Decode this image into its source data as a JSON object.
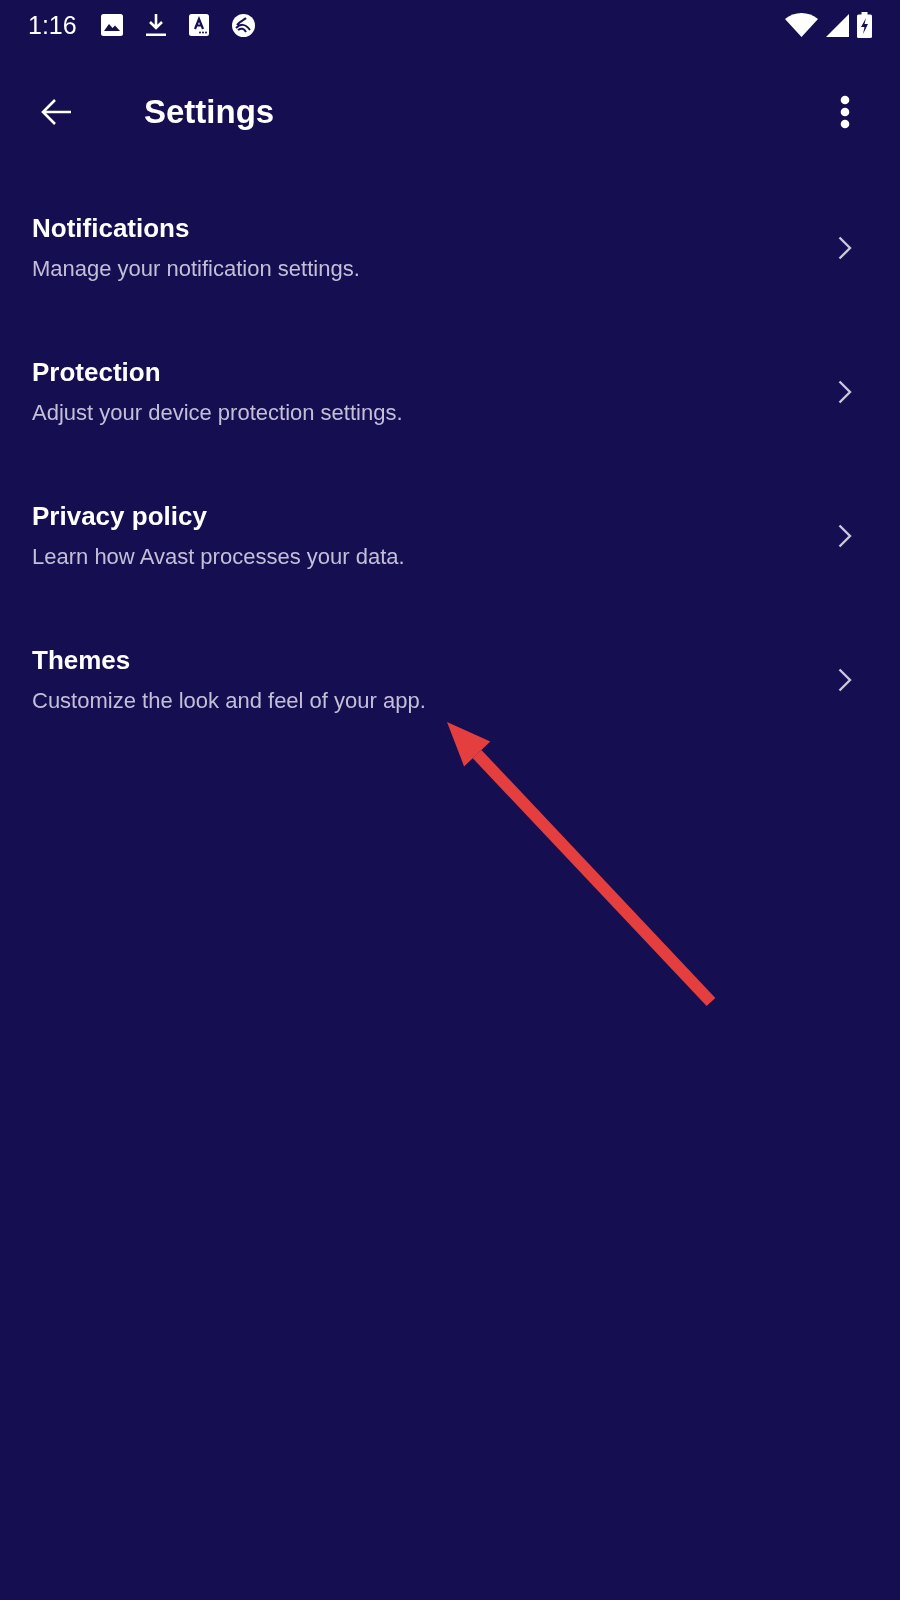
{
  "status_bar": {
    "time": "1:16"
  },
  "app_bar": {
    "title": "Settings"
  },
  "settings": [
    {
      "title": "Notifications",
      "description": "Manage your notification settings."
    },
    {
      "title": "Protection",
      "description": "Adjust your device protection settings."
    },
    {
      "title": "Privacy policy",
      "description": "Learn how Avast processes your data."
    },
    {
      "title": "Themes",
      "description": "Customize the look and feel of your app."
    }
  ],
  "annotation": {
    "kind": "arrow"
  }
}
